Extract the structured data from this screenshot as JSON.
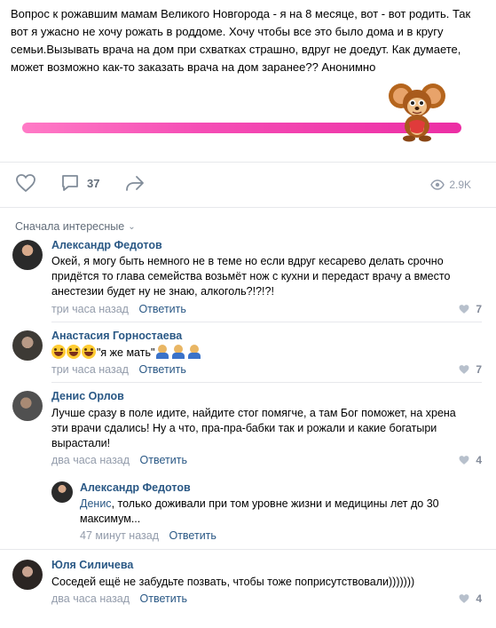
{
  "post": {
    "text": "Вопрос к рожавшим мамам Великого Новгорода - я на 8 месяце, вот - вот родить. Так вот я ужасно не хочу рожать в роддоме. Хочу чтобы все это было дома и в кругу семьи.Вызывать врача на дом при схватках страшно, вдруг не доедут. Как думаете, может возможно как-то заказать врача на дом заранее?? Анонимно"
  },
  "actions": {
    "comments_count": "37",
    "views_count": "2.9K"
  },
  "sort_label": "Сначала интересные",
  "colors": {
    "link": "#2a5885",
    "meta": "#939cab",
    "accent": "#ec2ea4"
  },
  "comments": [
    {
      "author": "Александр Федотов",
      "text": "Окей, я могу быть немного не в теме но если вдруг кесарево делать срочно придётся то глава семейства возьмёт нож с кухни и передаст врачу а вместо анестезии будет ну не знаю, алкоголь?!?!?!",
      "time": "три часа назад",
      "reply_label": "Ответить",
      "likes": "7"
    },
    {
      "author": "Анастасия Горностаева",
      "text": "\"я же мать\"",
      "time": "три часа назад",
      "reply_label": "Ответить",
      "likes": "7"
    },
    {
      "author": "Денис Орлов",
      "text": "Лучше сразу в поле идите, найдите стог помягче, а там Бог поможет, на хрена эти врачи сдались! Ну а что, пра-пра-бабки так и рожали и какие богатыри вырастали!",
      "time": "два часа назад",
      "reply_label": "Ответить",
      "likes": "4"
    },
    {
      "author": "Александр Федотов",
      "mention": "Денис",
      "text": ", только доживали при том уровне жизни и медицины лет до 30 максимум...",
      "time": "47 минут назад",
      "reply_label": "Ответить"
    },
    {
      "author": "Юля Силичева",
      "text": "Соседей ещё не забудьте позвать, чтобы тоже поприсутствовали)))))))",
      "time": "два часа назад",
      "reply_label": "Ответить",
      "likes": "4"
    }
  ]
}
